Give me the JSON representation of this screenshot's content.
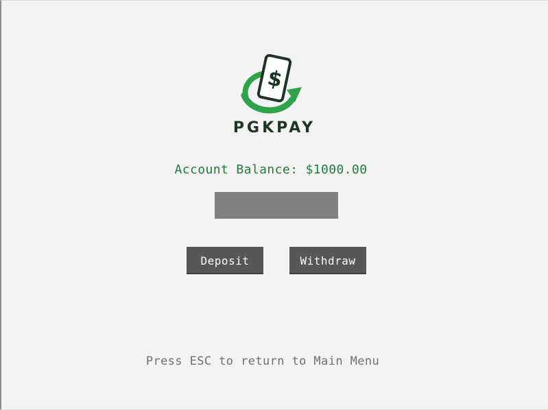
{
  "brand": {
    "name": "PGKPAY",
    "icon": "phone-dollar-logo",
    "colors": {
      "primary_green": "#2fa34a",
      "dark_green": "#1f3424"
    }
  },
  "account": {
    "balance_text": "Account Balance: $1000.00"
  },
  "amount_field": {
    "value": "",
    "placeholder": ""
  },
  "actions": {
    "deposit_label": "Deposit",
    "withdraw_label": "Withdraw"
  },
  "hint": {
    "text": "Press ESC to return to Main Menu"
  },
  "colors": {
    "background": "#f3f3f3",
    "button_bg": "#575757",
    "input_bg": "#808080",
    "balance_text": "#1f7b3b"
  }
}
